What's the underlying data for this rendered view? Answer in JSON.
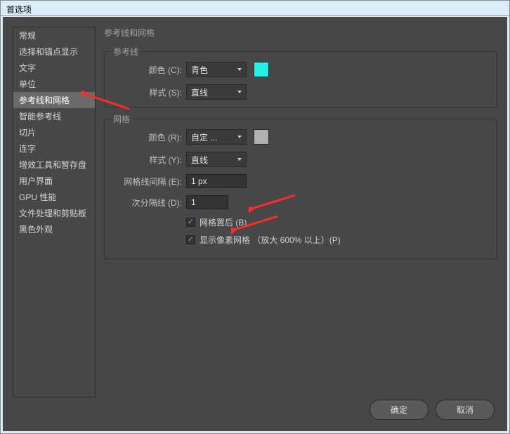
{
  "window": {
    "title": "首选项"
  },
  "sidebar": {
    "items": [
      {
        "label": "常规"
      },
      {
        "label": "选择和锚点显示"
      },
      {
        "label": "文字"
      },
      {
        "label": "单位"
      },
      {
        "label": "参考线和网格"
      },
      {
        "label": "智能参考线"
      },
      {
        "label": "切片"
      },
      {
        "label": "连字"
      },
      {
        "label": "增效工具和暂存盘"
      },
      {
        "label": "用户界面"
      },
      {
        "label": "GPU 性能"
      },
      {
        "label": "文件处理和剪贴板"
      },
      {
        "label": "黑色外观"
      }
    ],
    "selected": 4
  },
  "main": {
    "title": "参考线和网格",
    "guides": {
      "legend": "参考线",
      "color_label": "颜色 (C):",
      "color_value": "青色",
      "color_swatch": "#25f0e6",
      "style_label": "样式 (S):",
      "style_value": "直线"
    },
    "grid": {
      "legend": "网格",
      "color_label": "颜色 (R):",
      "color_value": "自定 ...",
      "color_swatch": "#b1b1b1",
      "style_label": "样式 (Y):",
      "style_value": "直线",
      "spacing_label": "网格线间隔 (E):",
      "spacing_value": "1 px",
      "subdiv_label": "次分隔线 (D):",
      "subdiv_value": "1",
      "cb1_label": "网格置后 (B)",
      "cb2_label": "显示像素网格 （放大 600% 以上）(P)"
    }
  },
  "buttons": {
    "ok": "确定",
    "cancel": "取消"
  }
}
